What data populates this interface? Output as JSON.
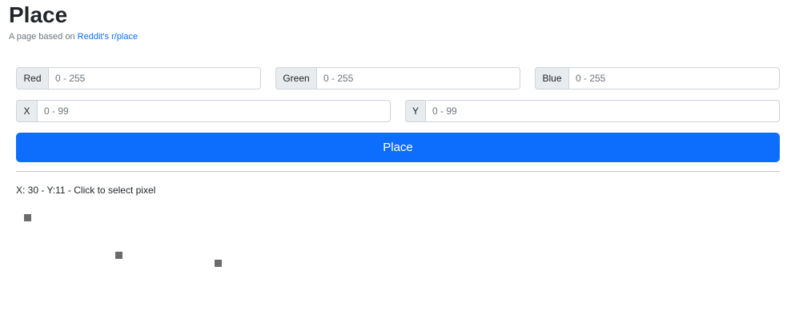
{
  "header": {
    "title": "Place",
    "subtitle_prefix": "A page based on ",
    "subtitle_link": "Reddit's r/place"
  },
  "form": {
    "red": {
      "label": "Red",
      "placeholder": "0 - 255",
      "value": ""
    },
    "green": {
      "label": "Green",
      "placeholder": "0 - 255",
      "value": ""
    },
    "blue": {
      "label": "Blue",
      "placeholder": "0 - 255",
      "value": ""
    },
    "x": {
      "label": "X",
      "placeholder": "0 - 99",
      "value": ""
    },
    "y": {
      "label": "Y",
      "placeholder": "0 - 99",
      "value": ""
    },
    "submit_label": "Place"
  },
  "status": {
    "text": "X: 30 - Y:11 - Click to select pixel"
  },
  "canvas": {
    "pixel_color": "#6b6b6b"
  },
  "colors": {
    "accent": "#0d6efd",
    "link": "#0d6efd"
  }
}
